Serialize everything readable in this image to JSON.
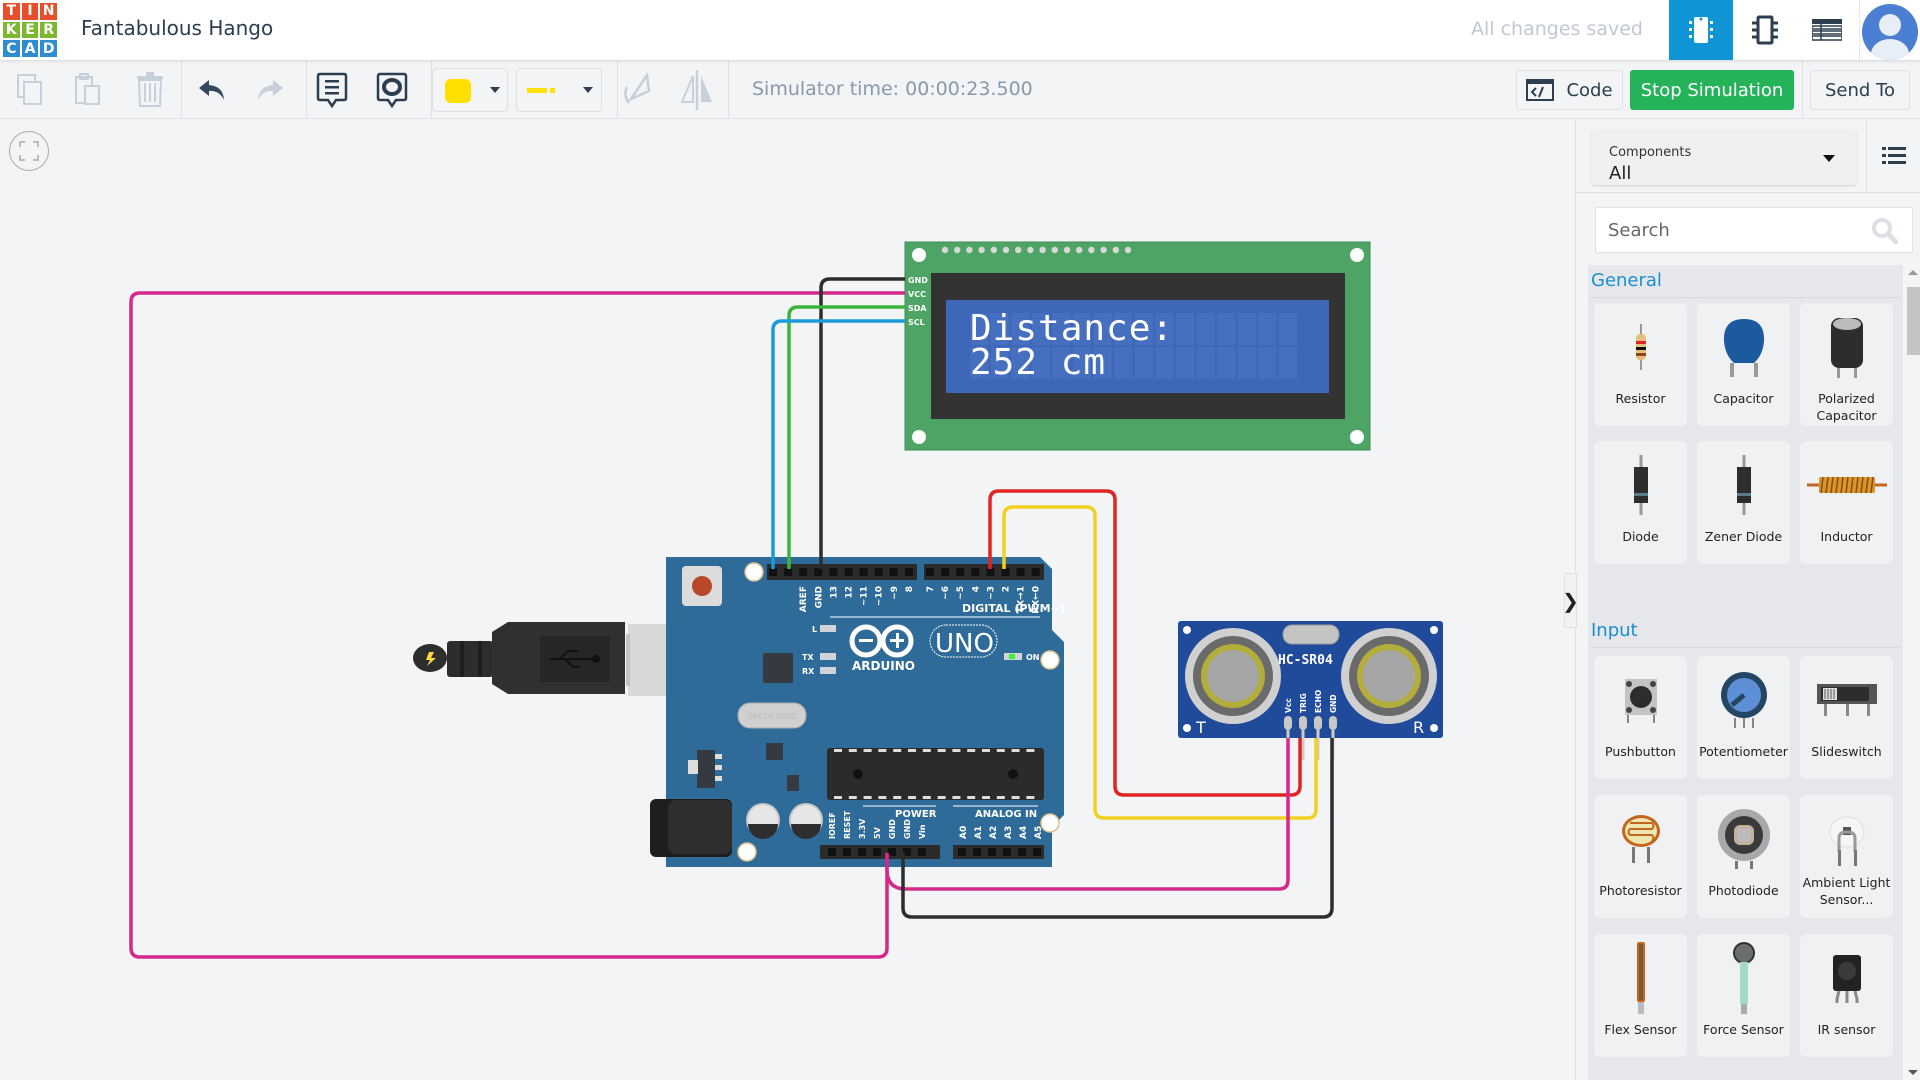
{
  "app": {
    "logo_letters": [
      "T",
      "I",
      "N",
      "K",
      "E",
      "R",
      "C",
      "A",
      "D"
    ],
    "project_title": "Fantabulous Hango",
    "save_status": "All changes saved",
    "view_icons": [
      "circuit-view-icon",
      "schematic-view-icon",
      "component-list-icon"
    ],
    "accent_color": "#0f95d5"
  },
  "toolbar": {
    "copy": "copy-icon",
    "paste": "paste-icon",
    "delete": "trash-icon",
    "undo": "undo-icon",
    "redo": "redo-icon",
    "notes": "notes-icon",
    "notes_toggle": "notes-visibility-icon",
    "wire_color": "#ffe000",
    "wire_type": "solid",
    "rotate": "rotate-icon",
    "flip": "flip-icon",
    "simulator_time": "Simulator time: 00:00:23.500",
    "code_label": "Code",
    "stop_label": "Stop Simulation",
    "send_label": "Send To",
    "stop_color": "#25b35a"
  },
  "circuit": {
    "lcd": {
      "pins": [
        "GND",
        "VCC",
        "SDA",
        "SCL"
      ],
      "line1": "Distance:",
      "line2": "252 cm"
    },
    "arduino": {
      "brand": "ARDUINO",
      "model": "UNO",
      "digital_label": "DIGITAL (PWM~)",
      "digital_pins": [
        "AREF",
        "GND",
        "13",
        "12",
        "~11",
        "~10",
        "~9",
        "8",
        "7",
        "~6",
        "~5",
        "4",
        "~3",
        "2",
        "TX→1",
        "RX←0"
      ],
      "power_label": "POWER",
      "power_pins": [
        "IOREF",
        "RESET",
        "3.3V",
        "5V",
        "GND",
        "GND",
        "Vin"
      ],
      "analog_label": "ANALOG IN",
      "analog_pins": [
        "A0",
        "A1",
        "A2",
        "A3",
        "A4",
        "A5"
      ],
      "leds": [
        "L",
        "TX",
        "RX"
      ],
      "on_label": "ON",
      "crystal": "SPK16.000G"
    },
    "sensor": {
      "model": "HC-SR04",
      "pins": [
        "Vcc",
        "TRIG",
        "ECHO",
        "GND"
      ],
      "left": "T",
      "right": "R"
    }
  },
  "sidebar": {
    "components_label": "Components",
    "components_value": "All",
    "search_placeholder": "Search",
    "categories": [
      {
        "name": "General",
        "items": [
          "Resistor",
          "Capacitor",
          "Polarized Capacitor",
          "Diode",
          "Zener Diode",
          "Inductor"
        ]
      },
      {
        "name": "Input",
        "items": [
          "Pushbutton",
          "Potentiometer",
          "Slideswitch",
          "Photoresistor",
          "Photodiode",
          "Ambient Light Sensor...",
          "Flex Sensor",
          "Force Sensor",
          "IR sensor"
        ]
      }
    ]
  }
}
